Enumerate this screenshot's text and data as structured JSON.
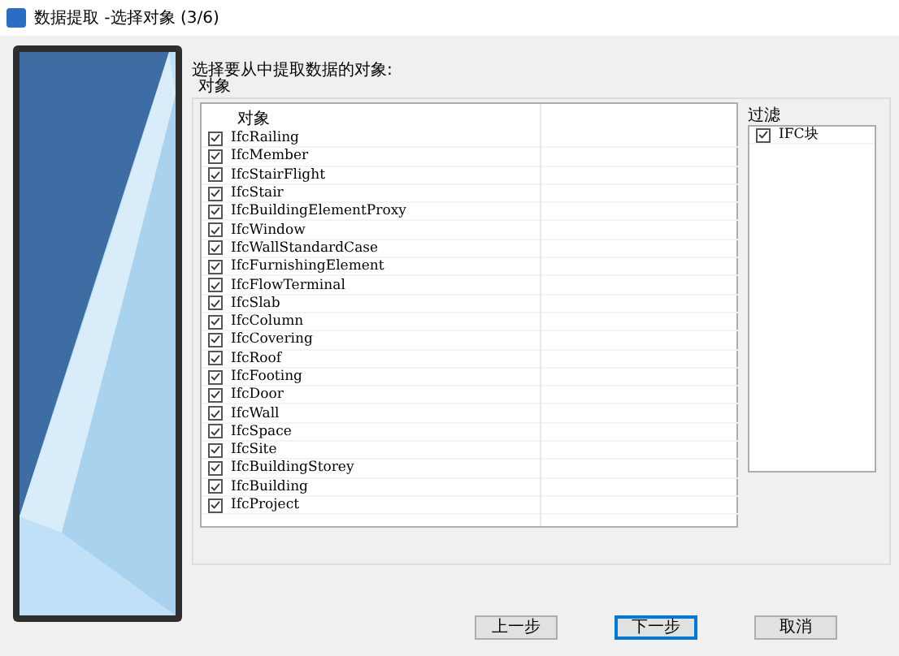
{
  "window": {
    "title": "数据提取 -选择对象 (3/6)"
  },
  "prompt": "选择要从中提取数据的对象:",
  "objects_group": {
    "label": "对象",
    "column_header": "对象",
    "items": [
      {
        "label": "IfcRailing",
        "checked": true
      },
      {
        "label": "IfcMember",
        "checked": true
      },
      {
        "label": "IfcStairFlight",
        "checked": true
      },
      {
        "label": "IfcStair",
        "checked": true
      },
      {
        "label": "IfcBuildingElementProxy",
        "checked": true
      },
      {
        "label": "IfcWindow",
        "checked": true
      },
      {
        "label": "IfcWallStandardCase",
        "checked": true
      },
      {
        "label": "IfcFurnishingElement",
        "checked": true
      },
      {
        "label": "IfcFlowTerminal",
        "checked": true
      },
      {
        "label": "IfcSlab",
        "checked": true
      },
      {
        "label": "IfcColumn",
        "checked": true
      },
      {
        "label": "IfcCovering",
        "checked": true
      },
      {
        "label": "IfcRoof",
        "checked": true
      },
      {
        "label": "IfcFooting",
        "checked": true
      },
      {
        "label": "IfcDoor",
        "checked": true
      },
      {
        "label": "IfcWall",
        "checked": true
      },
      {
        "label": "IfcSpace",
        "checked": true
      },
      {
        "label": "IfcSite",
        "checked": true
      },
      {
        "label": "IfcBuildingStorey",
        "checked": true
      },
      {
        "label": "IfcBuilding",
        "checked": true
      },
      {
        "label": "IfcProject",
        "checked": true
      }
    ]
  },
  "filter": {
    "label": "过滤",
    "items": [
      {
        "label": "IFC块",
        "checked": true
      }
    ]
  },
  "buttons": [
    {
      "label": "上一步",
      "default": false
    },
    {
      "label": "下一步",
      "default": true
    },
    {
      "label": "取消",
      "default": false
    }
  ]
}
